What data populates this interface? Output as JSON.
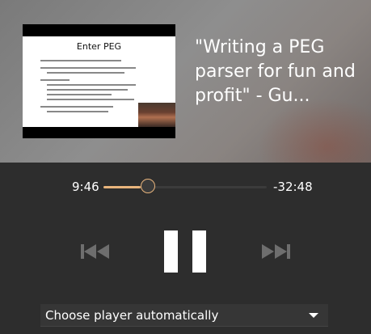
{
  "video": {
    "thumbnail_slide_title": "Enter PEG",
    "title": "\"Writing a PEG parser for fun and profit\" - Gu..."
  },
  "player": {
    "elapsed": "9:46",
    "remaining": "-32:48",
    "progress_fraction": 0.23,
    "accent_color": "#e8b47c",
    "prev_icon": "skip-previous-icon",
    "pause_icon": "pause-icon",
    "next_icon": "skip-next-icon"
  },
  "player_select": {
    "selected": "Choose player automatically",
    "caret_icon": "chevron-down-icon"
  }
}
